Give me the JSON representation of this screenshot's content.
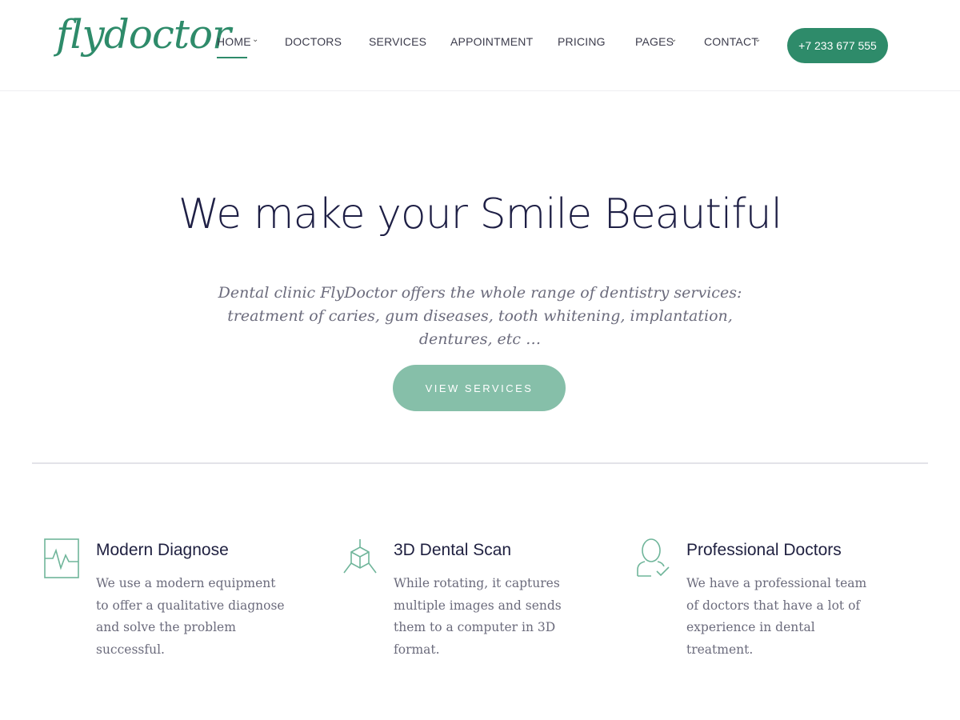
{
  "brand": {
    "logo_text": "flydoctor",
    "accent_color": "#2e8b6a"
  },
  "nav": {
    "items": [
      {
        "label": "HOME",
        "has_dropdown": true,
        "active": true
      },
      {
        "label": "DOCTORS",
        "has_dropdown": false
      },
      {
        "label": "SERVICES",
        "has_dropdown": false
      },
      {
        "label": "APPOINTMENT",
        "has_dropdown": false
      },
      {
        "label": "PRICING",
        "has_dropdown": false
      },
      {
        "label": "PAGES",
        "has_dropdown": true
      },
      {
        "label": "CONTACT",
        "has_dropdown": true
      }
    ],
    "phone_button": "+7 233 677 555"
  },
  "hero": {
    "title": "We make your Smile Beautiful",
    "subtitle": "Dental clinic FlyDoctor offers the whole range of dentistry services: treatment of caries, gum diseases, tooth whitening, implantation, dentures, etc …",
    "button_label": "VIEW SERVICES",
    "button_color": "#86bfa9"
  },
  "features": [
    {
      "icon": "heartbeat-monitor-icon",
      "title": "Modern Diagnose",
      "text": "We use a modern equipment to offer a qualitative diagnose and solve the problem successful."
    },
    {
      "icon": "3d-cube-icon",
      "title": "3D Dental Scan",
      "text": "While rotating, it captures multiple images and sends them to a computer in 3D format."
    },
    {
      "icon": "doctor-check-icon",
      "title": "Professional Doctors",
      "text": "We have a professional team of doctors that have a lot of experience in dental treatment."
    }
  ]
}
